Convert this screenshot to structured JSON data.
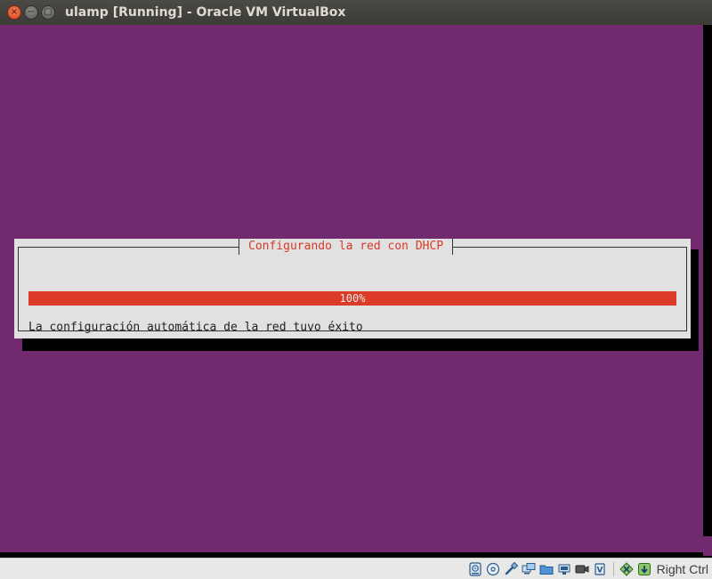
{
  "window": {
    "title": "ulamp [Running] - Oracle VM VirtualBox",
    "close_glyph": "×",
    "minimize_glyph": "−",
    "maximize_glyph": "□"
  },
  "dialog": {
    "title": "Configurando la red con DHCP",
    "progress_percent": 100,
    "progress_label": "100%",
    "message": "La configuración automática de la red tuvo éxito"
  },
  "colors": {
    "console_background": "#712a6e",
    "dialog_background": "#e1e1e1",
    "progress_fill": "#dc3b28",
    "dialog_title_text": "#d83a28"
  },
  "statusbar": {
    "icons": [
      "hard-disk-icon",
      "optical-drive-icon",
      "usb-icon",
      "display-icon",
      "shared-folders-icon",
      "network-icon",
      "recording-icon",
      "cpu-icon",
      "mouse-integration-icon",
      "keyboard-capture-icon"
    ],
    "host_key": "Right Ctrl"
  }
}
